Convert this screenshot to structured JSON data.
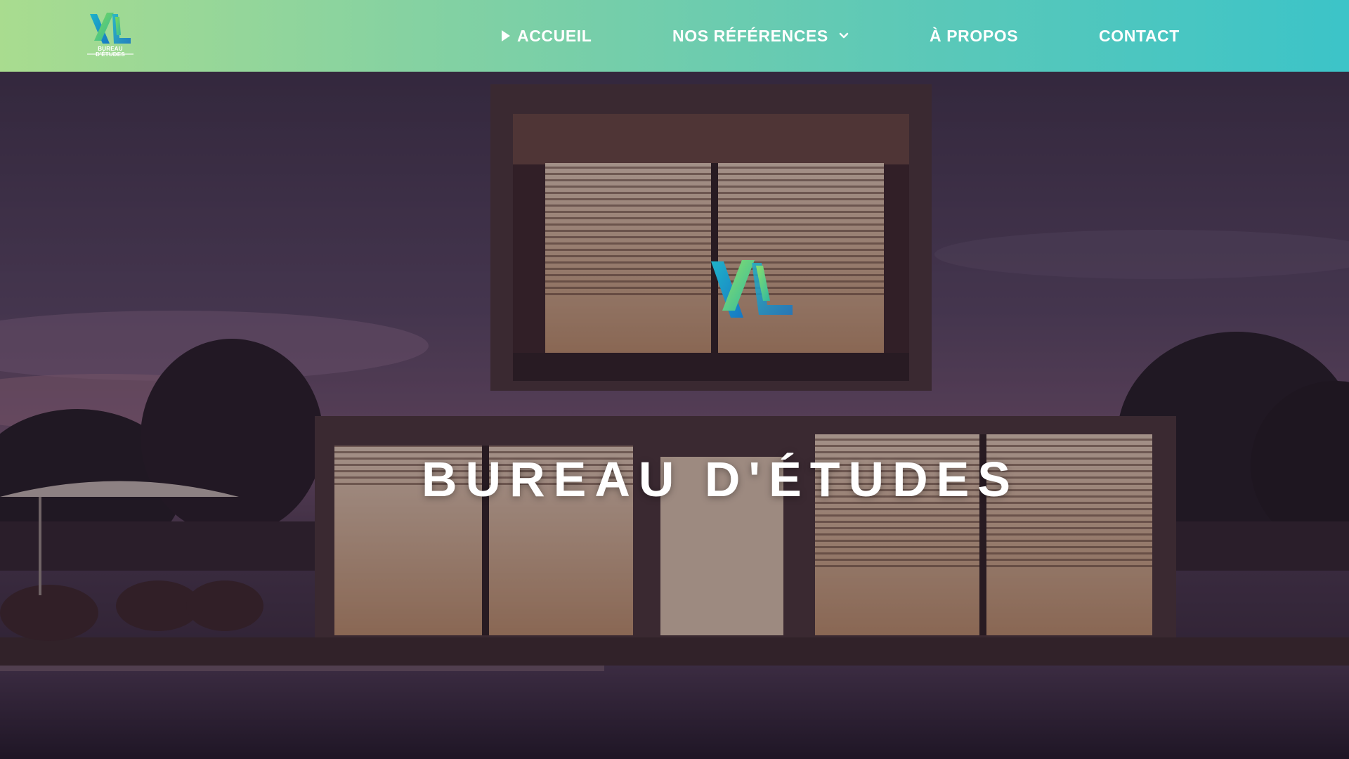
{
  "brand": {
    "logo_icon": "xl-logo-icon",
    "caption": "BUREAU D'ÉTUDES",
    "colors": {
      "teal": "#1fb3c9",
      "green": "#7ed957",
      "blue": "#1777c4"
    }
  },
  "header": {
    "gradient": [
      "#a9dc8f",
      "#3cc4c8"
    ],
    "nav": {
      "accueil": {
        "label": "ACCUEIL",
        "icon": "play-triangle-icon",
        "active": true
      },
      "references": {
        "label": "NOS RÉFÉRENCES",
        "icon": "chevron-down-icon"
      },
      "apropos": {
        "label": "À PROPOS"
      },
      "contact": {
        "label": "CONTACT"
      }
    }
  },
  "hero": {
    "title": "BUREAU D'ÉTUDES",
    "background": "modern-house-night-photo",
    "overlay_color": "#23162d"
  }
}
